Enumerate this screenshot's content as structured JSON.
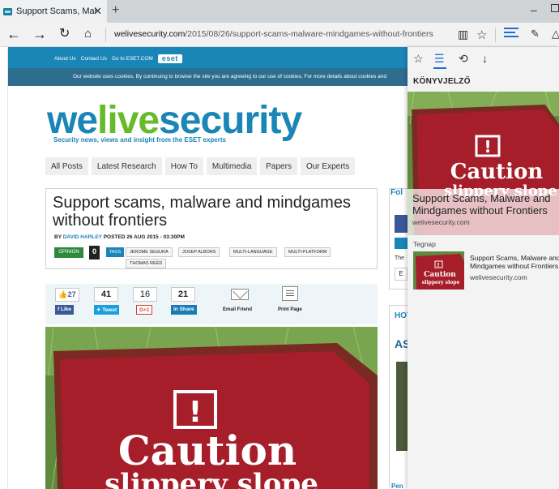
{
  "browser": {
    "tab_title": "Support Scams, Malwan",
    "new_tab_symbol": "+",
    "address_host": "welivesecurity.com",
    "address_path": "/2015/08/26/support-scams-malware-mindgames-without-frontiers",
    "minimize_symbol": "–"
  },
  "site": {
    "top_links": [
      "About Us",
      "Contact Us",
      "Go to ESET.COM"
    ],
    "eset_logo": "eset",
    "cookie_notice": "Our website uses cookies. By continuing to browse the site you are agreeing to our use of cookies. For more details about cookies and",
    "logo_parts": [
      "we",
      "live",
      "security"
    ],
    "tagline": "Security news, views and insight from the ESET experts",
    "menu": [
      "All Posts",
      "Latest Research",
      "How To",
      "Multimedia",
      "Papers",
      "Our Experts"
    ]
  },
  "article": {
    "title": "Support scams, malware and mindgames without frontiers",
    "byline_prefix": "BY",
    "author": "DAVID HARLEY",
    "posted": "POSTED 26 AUG 2015 - 03:30PM",
    "category": "OPINION",
    "comments": "0",
    "tags_label": "TAGS",
    "tags": [
      "JEROME SEGURA",
      "JOSEP ALBORS",
      "MULTI-LANGUAGE",
      "MULTI-PLATFORM",
      "THOMAS REED"
    ],
    "share": {
      "facebook_count": "27",
      "facebook_label": "Like",
      "twitter_count": "41",
      "twitter_label": "Tweet",
      "gplus_count": "16",
      "gplus_label": "G+1",
      "linkedin_count": "21",
      "linkedin_label": "Share",
      "email_label": "Email Friend",
      "print_label": "Print Page"
    },
    "image_sign": {
      "exclaim": "!",
      "word": "Caution",
      "word2": "slippery slope"
    }
  },
  "right_column": {
    "follow_heading": "Fol",
    "the_text": "The",
    "e_button": "E",
    "hot_heading": "HOT",
    "as_text": "AS",
    "bottom_text": "Pen"
  },
  "hub": {
    "header": "KÖNYVJELZŐ",
    "featured": {
      "title": "Support Scams, Malware and Mindgames without Frontiers",
      "url": "welivesecurity.com"
    },
    "section_label": "Tegnap",
    "items": [
      {
        "title": "Support Scams, Malware and Mindgames without Frontiers",
        "url": "welivesecurity.com"
      }
    ]
  },
  "colors": {
    "eset_blue": "#1a86b7",
    "eset_green": "#66bb2a",
    "edge_accent": "#1f6ed4",
    "sign_red": "#a61e2a"
  }
}
